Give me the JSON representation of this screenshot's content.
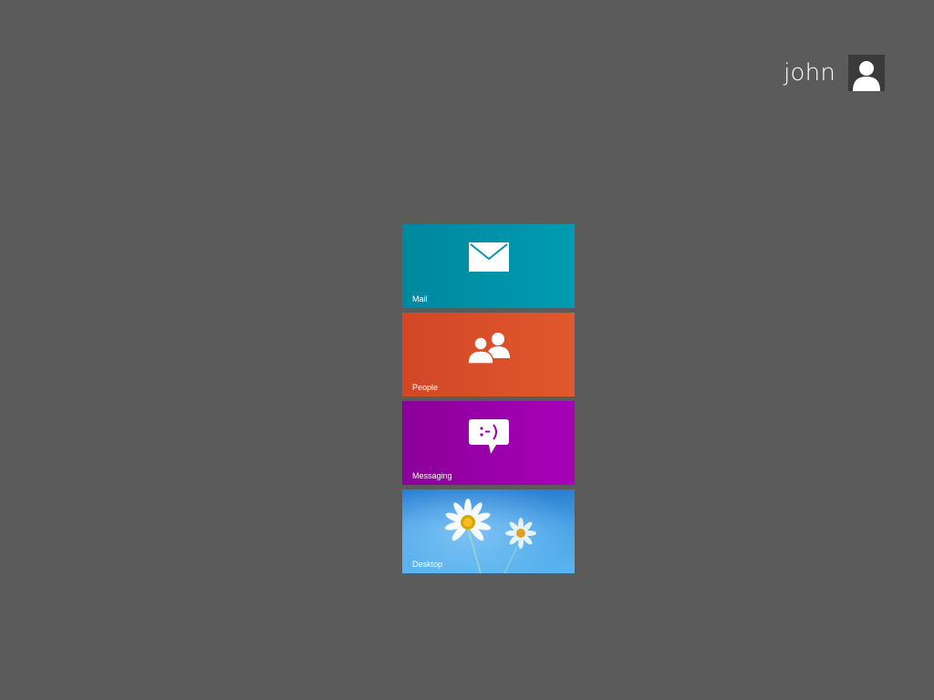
{
  "user": {
    "name": "john",
    "avatar_icon": "user-silhouette-icon"
  },
  "tiles": [
    {
      "label": "Mail",
      "icon": "mail-envelope-icon",
      "color": "#0094a8"
    },
    {
      "label": "People",
      "icon": "people-icon",
      "color": "#d9502a"
    },
    {
      "label": "Messaging",
      "icon": "chat-bubble-icon",
      "color": "#9900a8"
    },
    {
      "label": "Desktop",
      "icon": "desktop-wallpaper",
      "color": "#3b93dc"
    }
  ],
  "colors": {
    "background": "#5b5b5b",
    "text": "#ffffff"
  }
}
